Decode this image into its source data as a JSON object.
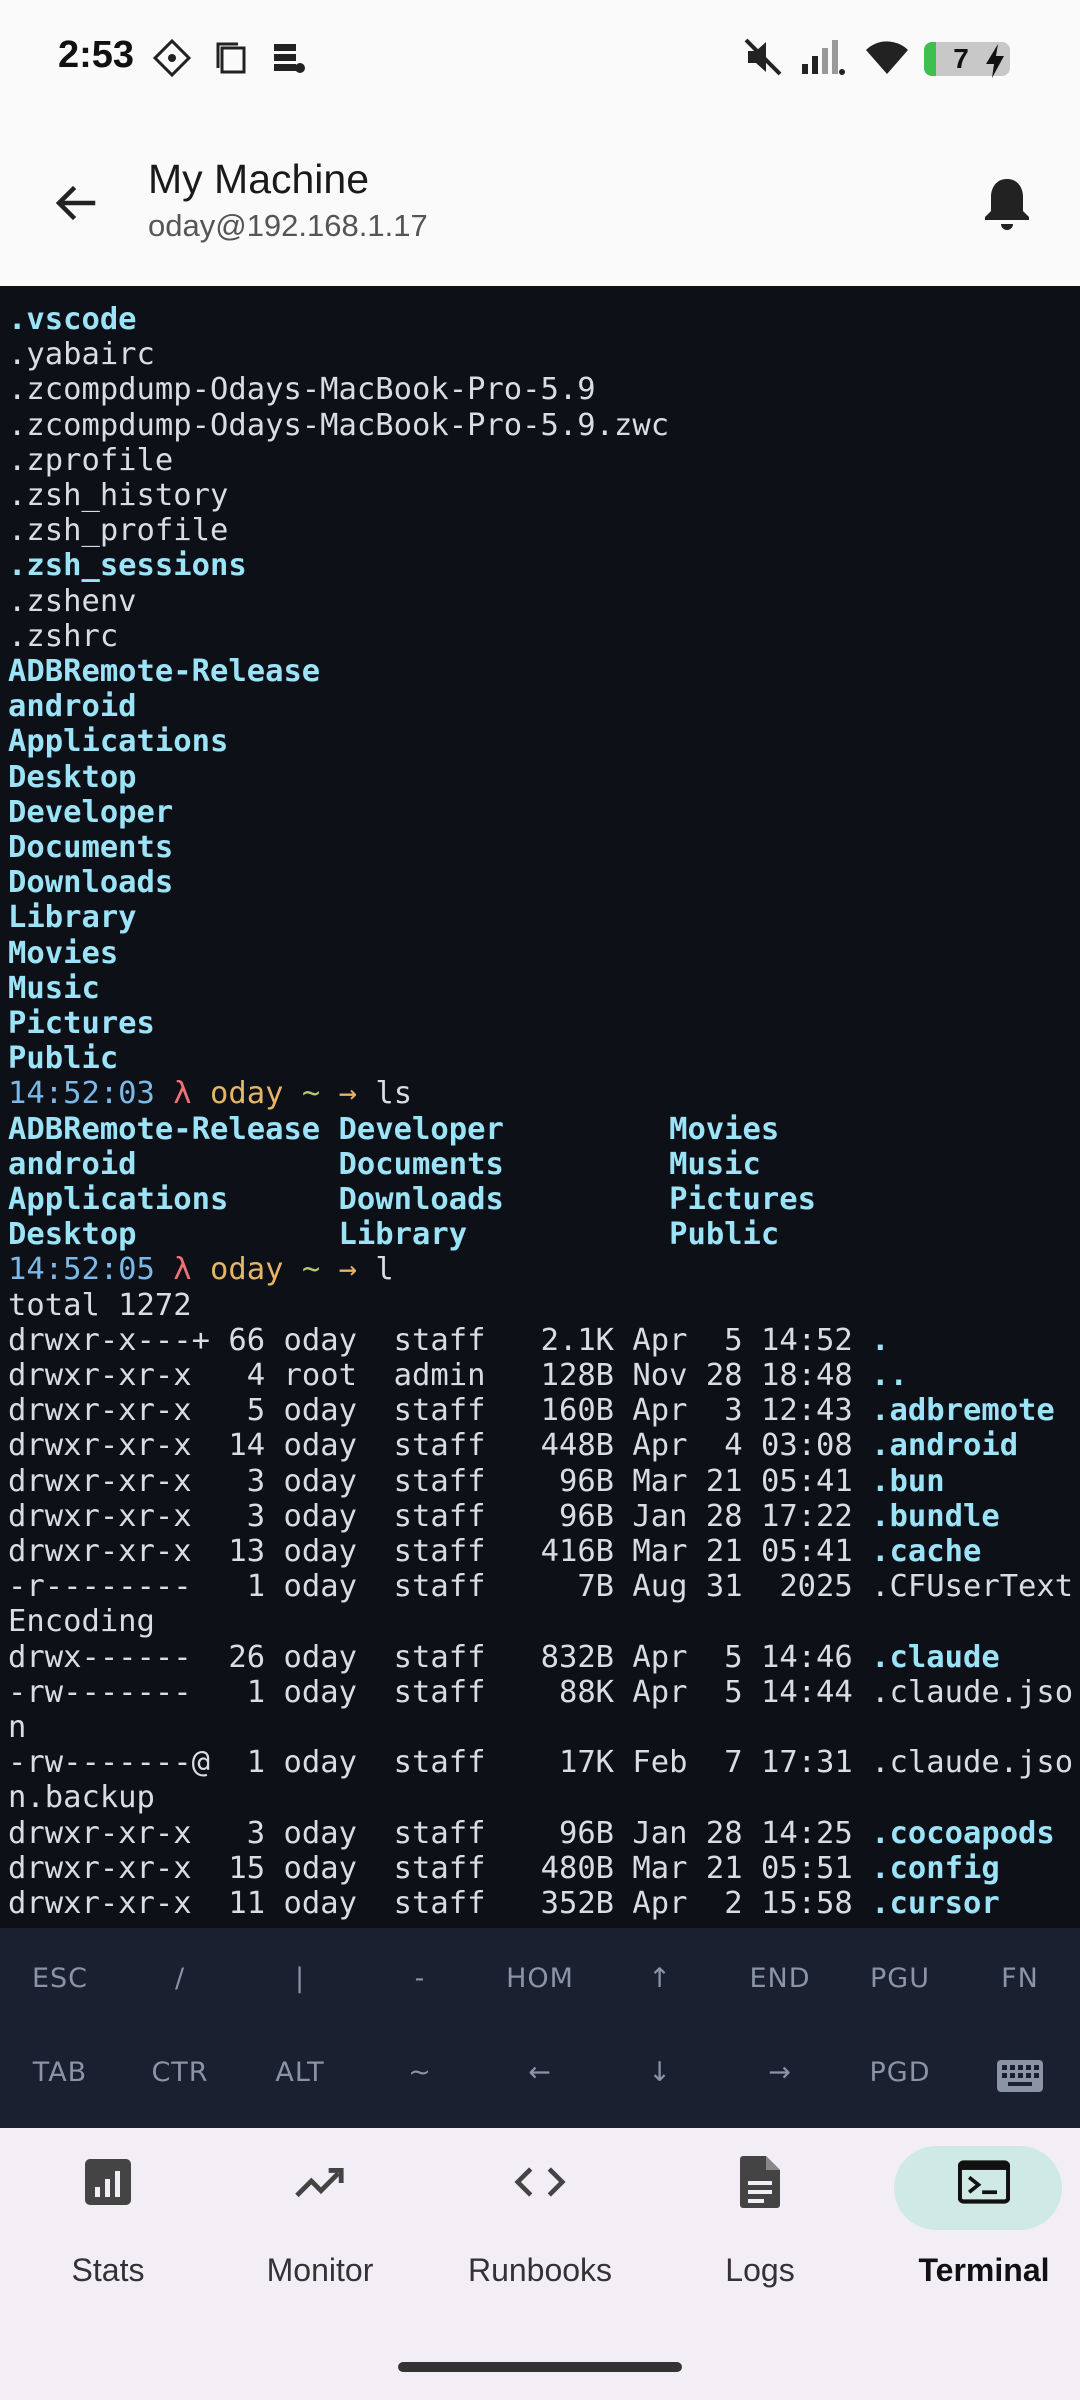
{
  "status_bar": {
    "time": "2:53",
    "battery": "7"
  },
  "header": {
    "title": "My Machine",
    "subtitle": "oday@192.168.1.17"
  },
  "terminal": {
    "dot_listing": [
      {
        "name": ".vscode",
        "dir": true
      },
      {
        "name": ".yabairc",
        "dir": false
      },
      {
        "name": ".zcompdump-Odays-MacBook-Pro-5.9",
        "dir": false
      },
      {
        "name": ".zcompdump-Odays-MacBook-Pro-5.9.zwc",
        "dir": false
      },
      {
        "name": ".zprofile",
        "dir": false
      },
      {
        "name": ".zsh_history",
        "dir": false
      },
      {
        "name": ".zsh_profile",
        "dir": false
      },
      {
        "name": ".zsh_sessions",
        "dir": true
      },
      {
        "name": ".zshenv",
        "dir": false
      },
      {
        "name": ".zshrc",
        "dir": false
      },
      {
        "name": "ADBRemote-Release",
        "dir": true
      },
      {
        "name": "android",
        "dir": true
      },
      {
        "name": "Applications",
        "dir": true
      },
      {
        "name": "Desktop",
        "dir": true
      },
      {
        "name": "Developer",
        "dir": true
      },
      {
        "name": "Documents",
        "dir": true
      },
      {
        "name": "Downloads",
        "dir": true
      },
      {
        "name": "Library",
        "dir": true
      },
      {
        "name": "Movies",
        "dir": true
      },
      {
        "name": "Music",
        "dir": true
      },
      {
        "name": "Pictures",
        "dir": true
      },
      {
        "name": "Public",
        "dir": true
      }
    ],
    "prompt1": {
      "time": "14:52:03",
      "lambda": "λ",
      "user": "oday",
      "cwd": "~",
      "arrow": "→",
      "cmd": "ls"
    },
    "ls_rows": [
      [
        "ADBRemote-Release",
        "Developer",
        "Movies"
      ],
      [
        "android",
        "Documents",
        "Music"
      ],
      [
        "Applications",
        "Downloads",
        "Pictures"
      ],
      [
        "Desktop",
        "Library",
        "Public"
      ]
    ],
    "prompt2": {
      "time": "14:52:05",
      "lambda": "λ",
      "user": "oday",
      "cwd": "~",
      "arrow": "→",
      "cmd": "l"
    },
    "total": "total 1272",
    "long_listing": [
      {
        "perm": "drwxr-x---+",
        "links": "66",
        "owner": "oday",
        "group": "staff",
        "size": "2.1K",
        "date": "Apr  5 14:52",
        "name": ".",
        "dir": true
      },
      {
        "perm": "drwxr-xr-x ",
        "links": " 4",
        "owner": "root",
        "group": "admin",
        "size": "128B",
        "date": "Nov 28 18:48",
        "name": "..",
        "dir": true
      },
      {
        "perm": "drwxr-xr-x ",
        "links": " 5",
        "owner": "oday",
        "group": "staff",
        "size": "160B",
        "date": "Apr  3 12:43",
        "name": ".adbremote",
        "dir": true
      },
      {
        "perm": "drwxr-xr-x ",
        "links": "14",
        "owner": "oday",
        "group": "staff",
        "size": "448B",
        "date": "Apr  4 03:08",
        "name": ".android",
        "dir": true
      },
      {
        "perm": "drwxr-xr-x ",
        "links": " 3",
        "owner": "oday",
        "group": "staff",
        "size": " 96B",
        "date": "Mar 21 05:41",
        "name": ".bun",
        "dir": true
      },
      {
        "perm": "drwxr-xr-x ",
        "links": " 3",
        "owner": "oday",
        "group": "staff",
        "size": " 96B",
        "date": "Jan 28 17:22",
        "name": ".bundle",
        "dir": true
      },
      {
        "perm": "drwxr-xr-x ",
        "links": "13",
        "owner": "oday",
        "group": "staff",
        "size": "416B",
        "date": "Mar 21 05:41",
        "name": ".cache",
        "dir": true
      },
      {
        "perm": "-r-------- ",
        "links": " 1",
        "owner": "oday",
        "group": "staff",
        "size": "  7B",
        "date": "Aug 31  2025",
        "name": ".CFUserText",
        "dir": false,
        "wrap": "Encoding"
      },
      {
        "perm": "drwx------ ",
        "links": "26",
        "owner": "oday",
        "group": "staff",
        "size": "832B",
        "date": "Apr  5 14:46",
        "name": ".claude",
        "dir": true
      },
      {
        "perm": "-rw------- ",
        "links": " 1",
        "owner": "oday",
        "group": "staff",
        "size": " 88K",
        "date": "Apr  5 14:44",
        "name": ".claude.jso",
        "dir": false,
        "wrap": "n"
      },
      {
        "perm": "-rw-------@",
        "links": " 1",
        "owner": "oday",
        "group": "staff",
        "size": " 17K",
        "date": "Feb  7 17:31",
        "name": ".claude.jso",
        "dir": false,
        "wrap": "n.backup"
      },
      {
        "perm": "drwxr-xr-x ",
        "links": " 3",
        "owner": "oday",
        "group": "staff",
        "size": " 96B",
        "date": "Jan 28 14:25",
        "name": ".cocoapods",
        "dir": true
      },
      {
        "perm": "drwxr-xr-x ",
        "links": "15",
        "owner": "oday",
        "group": "staff",
        "size": "480B",
        "date": "Mar 21 05:51",
        "name": ".config",
        "dir": true
      },
      {
        "perm": "drwxr-xr-x ",
        "links": "11",
        "owner": "oday",
        "group": "staff",
        "size": "352B",
        "date": "Apr  2 15:58",
        "name": ".cursor",
        "dir": true
      }
    ]
  },
  "extra_keys": {
    "row1": [
      "ESC",
      "/",
      "|",
      "-",
      "HOM",
      "↑",
      "END",
      "PGU",
      "FN"
    ],
    "row2": [
      "TAB",
      "CTR",
      "ALT",
      "~",
      "←",
      "↓",
      "→",
      "PGD"
    ]
  },
  "nav": [
    {
      "label": "Stats",
      "icon": "stats-icon"
    },
    {
      "label": "Monitor",
      "icon": "trending-up-icon"
    },
    {
      "label": "Runbooks",
      "icon": "code-icon"
    },
    {
      "label": "Logs",
      "icon": "document-icon"
    },
    {
      "label": "Terminal",
      "icon": "terminal-icon",
      "active": true
    }
  ]
}
